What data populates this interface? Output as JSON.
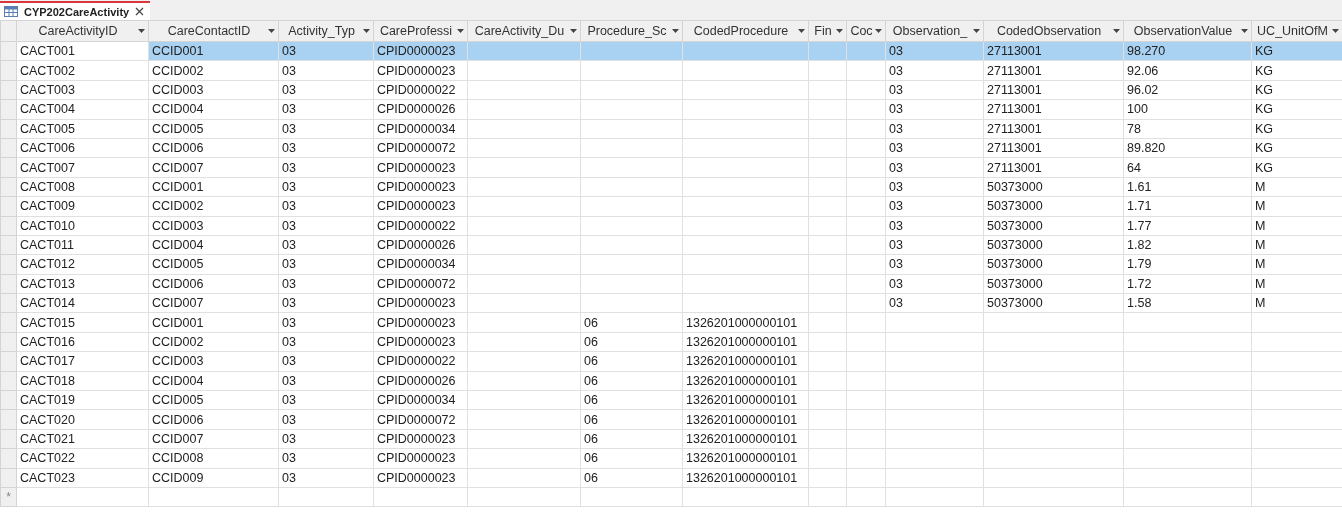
{
  "tab": {
    "title": "CYP202CareActivity",
    "selected": true
  },
  "table": {
    "columns": [
      "CareActivityID",
      "CareContactID",
      "Activity_Typ",
      "CareProfessi",
      "CareActivity_Du",
      "Procedure_Sc",
      "CodedProcedure",
      "Fin",
      "Coc",
      "Observation_",
      "CodedObservation",
      "ObservationValue",
      "UC_UnitOfM"
    ],
    "rows": [
      {
        "selected": true,
        "cells": [
          "CACT001",
          "CCID001",
          "03",
          "CPID0000023",
          null,
          null,
          null,
          null,
          null,
          "03",
          "27113001",
          "98.270",
          "KG"
        ]
      },
      {
        "selected": false,
        "cells": [
          "CACT002",
          "CCID002",
          "03",
          "CPID0000023",
          null,
          null,
          null,
          null,
          null,
          "03",
          "27113001",
          "92.06",
          "KG"
        ]
      },
      {
        "selected": false,
        "cells": [
          "CACT003",
          "CCID003",
          "03",
          "CPID0000022",
          null,
          null,
          null,
          null,
          null,
          "03",
          "27113001",
          "96.02",
          "KG"
        ]
      },
      {
        "selected": false,
        "cells": [
          "CACT004",
          "CCID004",
          "03",
          "CPID0000026",
          null,
          null,
          null,
          null,
          null,
          "03",
          "27113001",
          "100",
          "KG"
        ]
      },
      {
        "selected": false,
        "cells": [
          "CACT005",
          "CCID005",
          "03",
          "CPID0000034",
          null,
          null,
          null,
          null,
          null,
          "03",
          "27113001",
          "78",
          "KG"
        ]
      },
      {
        "selected": false,
        "cells": [
          "CACT006",
          "CCID006",
          "03",
          "CPID0000072",
          null,
          null,
          null,
          null,
          null,
          "03",
          "27113001",
          "89.820",
          "KG"
        ]
      },
      {
        "selected": false,
        "cells": [
          "CACT007",
          "CCID007",
          "03",
          "CPID0000023",
          null,
          null,
          null,
          null,
          null,
          "03",
          "27113001",
          "64",
          "KG"
        ]
      },
      {
        "selected": false,
        "cells": [
          "CACT008",
          "CCID001",
          "03",
          "CPID0000023",
          null,
          null,
          null,
          null,
          null,
          "03",
          "50373000",
          "1.61",
          "M"
        ]
      },
      {
        "selected": false,
        "cells": [
          "CACT009",
          "CCID002",
          "03",
          "CPID0000023",
          null,
          null,
          null,
          null,
          null,
          "03",
          "50373000",
          "1.71",
          "M"
        ]
      },
      {
        "selected": false,
        "cells": [
          "CACT010",
          "CCID003",
          "03",
          "CPID0000022",
          null,
          null,
          null,
          null,
          null,
          "03",
          "50373000",
          "1.77",
          "M"
        ]
      },
      {
        "selected": false,
        "cells": [
          "CACT011",
          "CCID004",
          "03",
          "CPID0000026",
          null,
          null,
          null,
          null,
          null,
          "03",
          "50373000",
          "1.82",
          "M"
        ]
      },
      {
        "selected": false,
        "cells": [
          "CACT012",
          "CCID005",
          "03",
          "CPID0000034",
          null,
          null,
          null,
          null,
          null,
          "03",
          "50373000",
          "1.79",
          "M"
        ]
      },
      {
        "selected": false,
        "cells": [
          "CACT013",
          "CCID006",
          "03",
          "CPID0000072",
          null,
          null,
          null,
          null,
          null,
          "03",
          "50373000",
          "1.72",
          "M"
        ]
      },
      {
        "selected": false,
        "cells": [
          "CACT014",
          "CCID007",
          "03",
          "CPID0000023",
          null,
          null,
          null,
          null,
          null,
          "03",
          "50373000",
          "1.58",
          "M"
        ]
      },
      {
        "selected": false,
        "cells": [
          "CACT015",
          "CCID001",
          "03",
          "CPID0000023",
          null,
          "06",
          "1326201000000101",
          null,
          null,
          null,
          null,
          null,
          null
        ]
      },
      {
        "selected": false,
        "cells": [
          "CACT016",
          "CCID002",
          "03",
          "CPID0000023",
          null,
          "06",
          "1326201000000101",
          null,
          null,
          null,
          null,
          null,
          null
        ]
      },
      {
        "selected": false,
        "cells": [
          "CACT017",
          "CCID003",
          "03",
          "CPID0000022",
          null,
          "06",
          "1326201000000101",
          null,
          null,
          null,
          null,
          null,
          null
        ]
      },
      {
        "selected": false,
        "cells": [
          "CACT018",
          "CCID004",
          "03",
          "CPID0000026",
          null,
          "06",
          "1326201000000101",
          null,
          null,
          null,
          null,
          null,
          null
        ]
      },
      {
        "selected": false,
        "cells": [
          "CACT019",
          "CCID005",
          "03",
          "CPID0000034",
          null,
          "06",
          "1326201000000101",
          null,
          null,
          null,
          null,
          null,
          null
        ]
      },
      {
        "selected": false,
        "cells": [
          "CACT020",
          "CCID006",
          "03",
          "CPID0000072",
          null,
          "06",
          "1326201000000101",
          null,
          null,
          null,
          null,
          null,
          null
        ]
      },
      {
        "selected": false,
        "cells": [
          "CACT021",
          "CCID007",
          "03",
          "CPID0000023",
          null,
          "06",
          "1326201000000101",
          null,
          null,
          null,
          null,
          null,
          null
        ]
      },
      {
        "selected": false,
        "cells": [
          "CACT022",
          "CCID008",
          "03",
          "CPID0000023",
          null,
          "06",
          "1326201000000101",
          null,
          null,
          null,
          null,
          null,
          null
        ]
      },
      {
        "selected": false,
        "cells": [
          "CACT023",
          "CCID009",
          "03",
          "CPID0000023",
          null,
          "06",
          "1326201000000101",
          null,
          null,
          null,
          null,
          null,
          null
        ]
      }
    ],
    "new_row_marker": "*"
  }
}
